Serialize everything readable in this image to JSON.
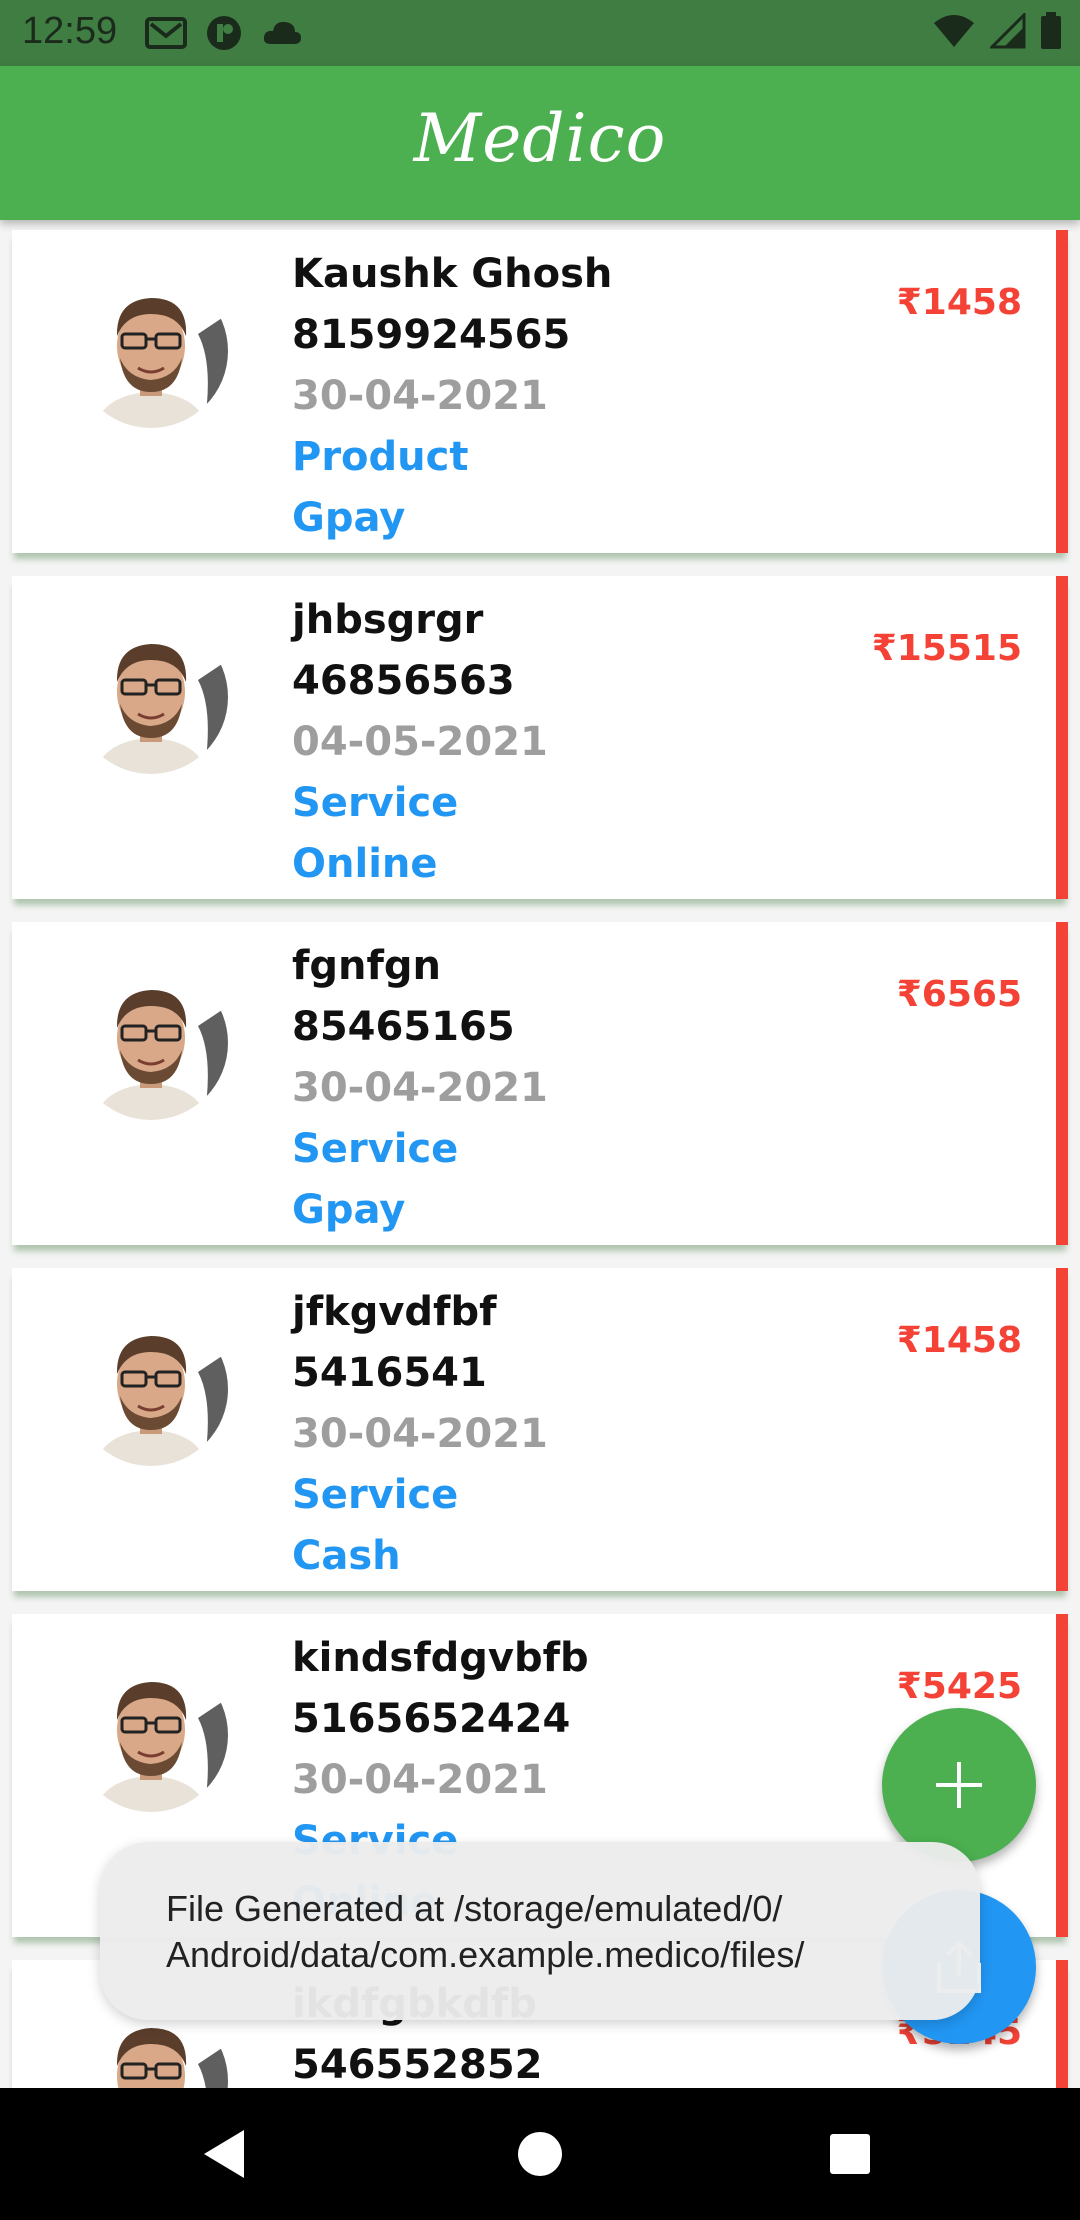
{
  "status_bar": {
    "time": "12:59",
    "left_icons": [
      "gmail-icon",
      "notification-icon",
      "cloud-icon"
    ],
    "right_icons": [
      "wifi-icon",
      "signal-icon",
      "battery-icon"
    ]
  },
  "app_bar": {
    "title": "Medico",
    "color": "#4caf50"
  },
  "records": [
    {
      "name": "Kaushk Ghosh",
      "phone": "8159924565",
      "date": "30-04-2021",
      "type": "Product",
      "payment": "Gpay",
      "amount": "₹1458"
    },
    {
      "name": "jhbsgrgr",
      "phone": "46856563",
      "date": "04-05-2021",
      "type": "Service",
      "payment": "Online",
      "amount": "₹15515"
    },
    {
      "name": "fgnfgn",
      "phone": "85465165",
      "date": "30-04-2021",
      "type": "Service",
      "payment": "Gpay",
      "amount": "₹6565"
    },
    {
      "name": "jfkgvdfbf",
      "phone": "5416541",
      "date": "30-04-2021",
      "type": "Service",
      "payment": "Cash",
      "amount": "₹1458"
    },
    {
      "name": "kindsfdgvbfb",
      "phone": "5165652424",
      "date": "30-04-2021",
      "type": "Service",
      "payment": "Online",
      "amount": "₹5425"
    },
    {
      "name": "ikdfgbkdfb",
      "phone": "546552852",
      "date": "",
      "type": "",
      "payment": "",
      "amount": "₹5245"
    }
  ],
  "fab_add": {
    "icon": "plus-icon",
    "color": "#4caf50"
  },
  "fab_share": {
    "icon": "share-icon",
    "color": "#2196f3"
  },
  "snackbar": {
    "line1": "File Generated at /storage/emulated/0/",
    "line2": "Android/data/com.example.medico/files/"
  },
  "nav_bar": {
    "icons": [
      "back-icon",
      "home-icon",
      "recents-icon"
    ]
  },
  "colors": {
    "amount": "#f44336",
    "accent_blue": "#2196f3",
    "date_gray": "#9e9e9e"
  }
}
